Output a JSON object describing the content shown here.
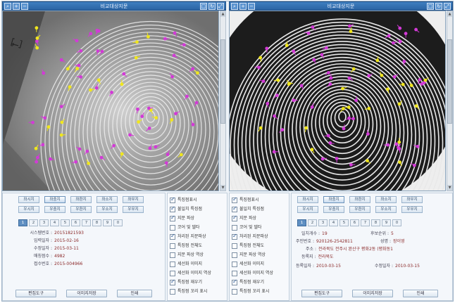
{
  "left_window": {
    "title": "비교대상지문"
  },
  "right_window": {
    "title": "비교대상지문"
  },
  "finger_buttons": [
    "좌시지",
    "좌중지",
    "좌환지",
    "좌소지",
    "좌무지",
    "우시지",
    "우중지",
    "우환지",
    "우소지",
    "우무지"
  ],
  "num_tabs": [
    "1",
    "2",
    "3",
    "4",
    "5",
    "6",
    "7",
    "8",
    "9",
    "0"
  ],
  "left_selected_finger": "좌중지",
  "right_selected_finger": "좌중지",
  "left_info": [
    {
      "label": "시스템번호 :",
      "value": "20151821593"
    },
    {
      "label": "입력일자 :",
      "value": "2015-02-16"
    },
    {
      "label": "수정일자 :",
      "value": "2015-03-11"
    },
    {
      "label": "매칭점수 :",
      "value": "4982"
    },
    {
      "label": "접수번호 :",
      "value": "2015-004966"
    }
  ],
  "right_info": {
    "line1_label": "일치개수 :",
    "line1_value": "19",
    "line1b_label": "후보순위 :",
    "line1b_value": "5",
    "line2_label": "주민번호 :",
    "line2_value": "920126-2542811",
    "line2b_label": "성명 :",
    "line2b_value": "장이영",
    "line3_label": "주소 :",
    "line3_value": "전라북도 전주시 완산구 평화2동 (평화동1",
    "line4_label": "등록지 :",
    "line4_value": "전라북도",
    "line5_label": "등록일자 :",
    "line5_value": "2010-03-15",
    "line5b_label": "수정일자 :",
    "line5b_value": "2010-03-15"
  },
  "action_buttons": [
    "편집도구",
    "이미지저장",
    "인쇄"
  ],
  "left_checks": [
    {
      "label": "특징점표시",
      "checked": true
    },
    {
      "label": "불일치 특징점",
      "checked": true
    },
    {
      "label": "지문 파상",
      "checked": true
    },
    {
      "label": "코어 및 델타",
      "checked": false
    },
    {
      "label": "처리된 지문파상",
      "checked": true
    },
    {
      "label": "특징점 전체도",
      "checked": false
    },
    {
      "label": "지문 파상 역상",
      "checked": false
    },
    {
      "label": "세선화 이미지",
      "checked": false
    },
    {
      "label": "세선화 이미지 역상",
      "checked": false
    },
    {
      "label": "특징점 재우기",
      "checked": true
    },
    {
      "label": "특징점 꼬리 표시",
      "checked": false
    }
  ],
  "right_checks": [
    {
      "label": "특징점표시",
      "checked": true
    },
    {
      "label": "불일치 특징점",
      "checked": true
    },
    {
      "label": "지문 파상",
      "checked": true
    },
    {
      "label": "코어 및 델타",
      "checked": false
    },
    {
      "label": "처리된 지문파상",
      "checked": true
    },
    {
      "label": "특징점 전체도",
      "checked": false
    },
    {
      "label": "지문 파상 역상",
      "checked": false
    },
    {
      "label": "세선화 이미지",
      "checked": false
    },
    {
      "label": "세선화 이미지 역상",
      "checked": false
    },
    {
      "label": "특징점 재우기",
      "checked": true
    },
    {
      "label": "특징점 꼬리 표시",
      "checked": false
    }
  ],
  "colors": {
    "match_minutia": "#f0e61e",
    "nonmatch_minutia": "#d23ad6",
    "titlebar": "#2f6fb2"
  },
  "titlebar_icons": [
    "search-icon",
    "zoom-in-icon",
    "zoom-out-icon",
    "fit-icon",
    "close-icon"
  ]
}
